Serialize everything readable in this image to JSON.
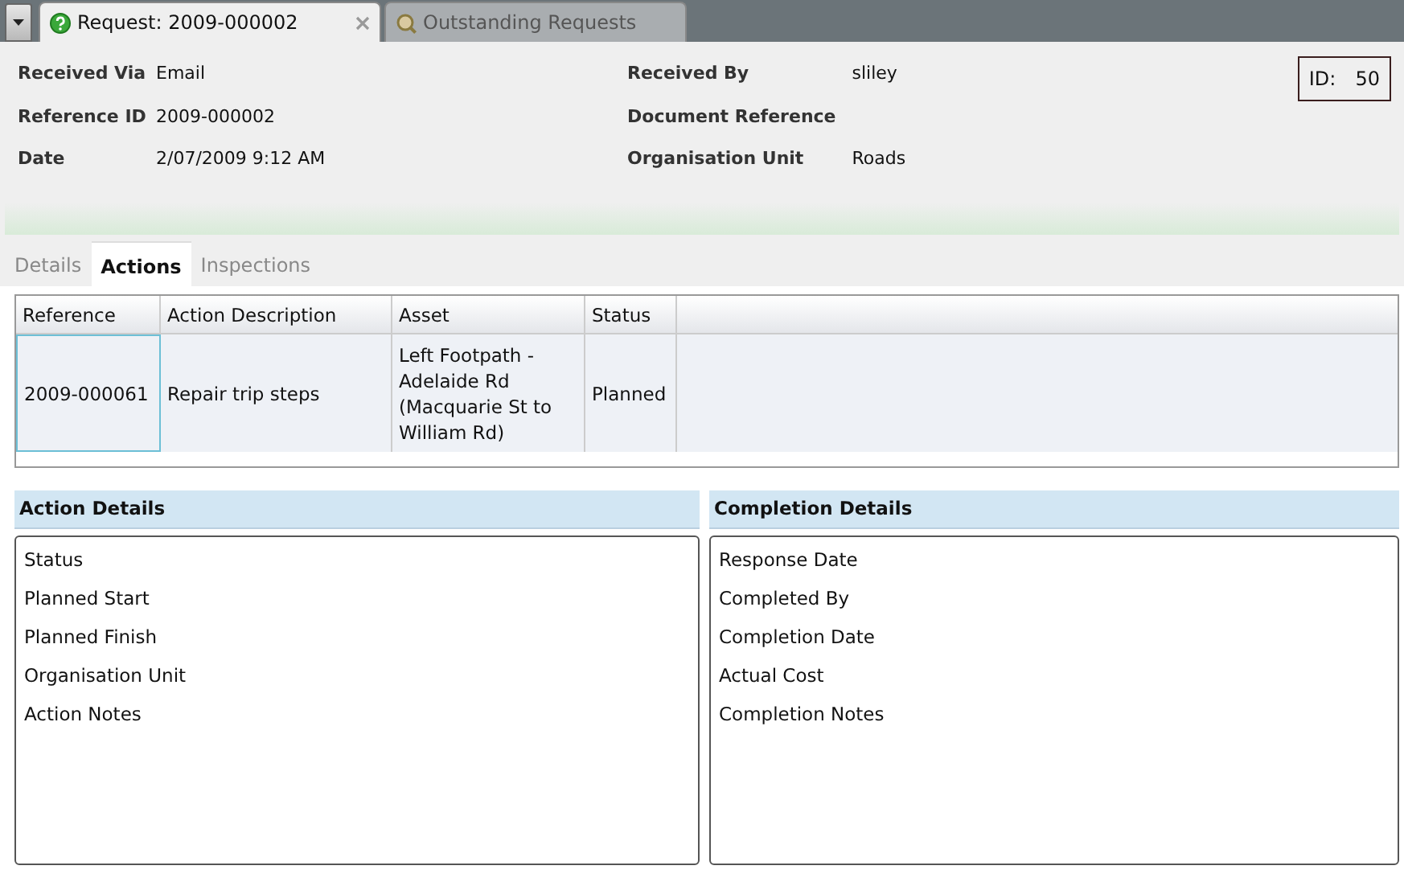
{
  "doc_tabs": [
    {
      "label": "Request: 2009-000002",
      "selected": true,
      "closable": true,
      "kind": "help"
    },
    {
      "label": "Outstanding Requests",
      "selected": false,
      "closable": false,
      "kind": "search"
    }
  ],
  "header": {
    "left_fields": [
      {
        "label": "Received Via",
        "value": "Email"
      },
      {
        "label": "Reference ID",
        "value": "2009-000002"
      },
      {
        "label": "Date",
        "value": "2/07/2009 9:12 AM"
      }
    ],
    "right_fields": [
      {
        "label": "Received By",
        "value": "sliley"
      },
      {
        "label": "Document Reference"
      },
      {
        "label": "Organisation Unit",
        "value": "Roads"
      }
    ],
    "id_label": "ID:",
    "id_value": "50"
  },
  "section_tabs": [
    {
      "label": "Details",
      "selected": false
    },
    {
      "label": "Actions",
      "selected": true
    },
    {
      "label": "Inspections",
      "selected": false
    }
  ],
  "table": {
    "columns": [
      "Reference",
      "Action Description",
      "Asset",
      "Status"
    ],
    "rows": [
      {
        "cells": [
          "2009-000061",
          "Repair trip steps",
          "Left Footpath - Adelaide Rd (Macquarie St to William Rd)",
          "Planned"
        ],
        "selected": true
      }
    ]
  },
  "panels": [
    {
      "title": "Action Details",
      "fields": [
        "Status",
        "Planned Start",
        "Planned Finish",
        "Organisation Unit",
        "Action Notes"
      ]
    },
    {
      "title": "Completion Details",
      "fields": [
        "Response Date",
        "Completed By",
        "Completion Date",
        "Actual Cost",
        "Completion Notes"
      ]
    }
  ]
}
